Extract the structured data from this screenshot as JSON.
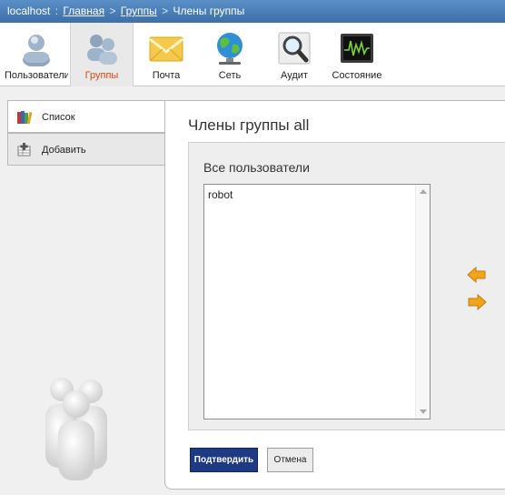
{
  "breadcrumb": {
    "host": "localhost",
    "sep1": ":",
    "home": "Главная",
    "sep2": ">",
    "groups": "Группы",
    "sep3": ">",
    "current": "Члены группы"
  },
  "toolbar": {
    "items": [
      {
        "label": "Пользователи",
        "icon": "user-icon"
      },
      {
        "label": "Группы",
        "icon": "group-icon"
      },
      {
        "label": "Почта",
        "icon": "mail-envelope-icon"
      },
      {
        "label": "Сеть",
        "icon": "globe-network-icon"
      },
      {
        "label": "Аудит",
        "icon": "magnifier-icon"
      },
      {
        "label": "Состояние",
        "icon": "monitor-status-icon"
      }
    ],
    "active": "Группы",
    "active_color": "#d24b12"
  },
  "sidebar": {
    "items": [
      {
        "label": "Список",
        "icon": "books-list-icon"
      },
      {
        "label": "Добавить",
        "icon": "add-grid-icon"
      }
    ]
  },
  "main": {
    "title": "Члены группы all",
    "all_users_title": "Все пользователи",
    "all_users": [
      "robot"
    ],
    "move_left_icon": "arrow-left-icon",
    "move_right_icon": "arrow-right-icon",
    "confirm_label": "Подтвердить",
    "cancel_label": "Отмена"
  },
  "colors": {
    "header_bar": "#4a7fbb",
    "confirm_button": "#1f3a85",
    "arrow": "#f2a51a"
  }
}
